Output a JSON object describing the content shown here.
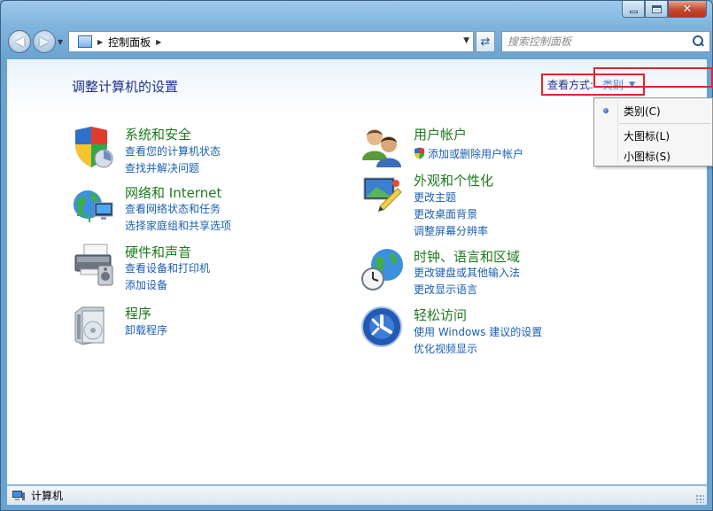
{
  "window": {
    "caption_buttons": {
      "minimize": "minimize",
      "maximize": "maximize",
      "close": "✕"
    }
  },
  "navbar": {
    "address_path": "控制面板",
    "search_placeholder": "搜索控制面板"
  },
  "content": {
    "page_title": "调整计算机的设置",
    "view_by": {
      "label": "查看方式:",
      "value": "类别"
    },
    "view_menu": {
      "items": [
        {
          "label": "类别(C)",
          "selected": true
        },
        {
          "label": "大图标(L)",
          "selected": false,
          "highlighted": true
        },
        {
          "label": "小图标(S)",
          "selected": false
        }
      ]
    },
    "categories_left": [
      {
        "title": "系统和安全",
        "icon": "shield-icon",
        "links": [
          "查看您的计算机状态",
          "查找并解决问题"
        ]
      },
      {
        "title": "网络和 Internet",
        "icon": "network-icon",
        "links": [
          "查看网络状态和任务",
          "选择家庭组和共享选项"
        ]
      },
      {
        "title": "硬件和声音",
        "icon": "printer-icon",
        "links": [
          "查看设备和打印机",
          "添加设备"
        ]
      },
      {
        "title": "程序",
        "icon": "programs-icon",
        "links": [
          "卸载程序"
        ]
      }
    ],
    "categories_right": [
      {
        "title": "用户帐户",
        "icon": "users-icon",
        "links": [
          "添加或删除用户帐户"
        ]
      },
      {
        "title": "外观和个性化",
        "icon": "appearance-icon",
        "links": [
          "更改主题",
          "更改桌面背景",
          "调整屏幕分辨率"
        ]
      },
      {
        "title": "时钟、语言和区域",
        "icon": "globe-clock-icon",
        "links": [
          "更改键盘或其他输入法",
          "更改显示语言"
        ]
      },
      {
        "title": "轻松访问",
        "icon": "ease-of-access-icon",
        "links": [
          "使用 Windows 建议的设置",
          "优化视频显示"
        ]
      }
    ]
  },
  "statusbar": {
    "text": "计算机"
  },
  "colors": {
    "category_title": "#1e7a1e",
    "link": "#1a5fb0",
    "heading": "#1e3287",
    "annotation_red": "#e0262a"
  }
}
